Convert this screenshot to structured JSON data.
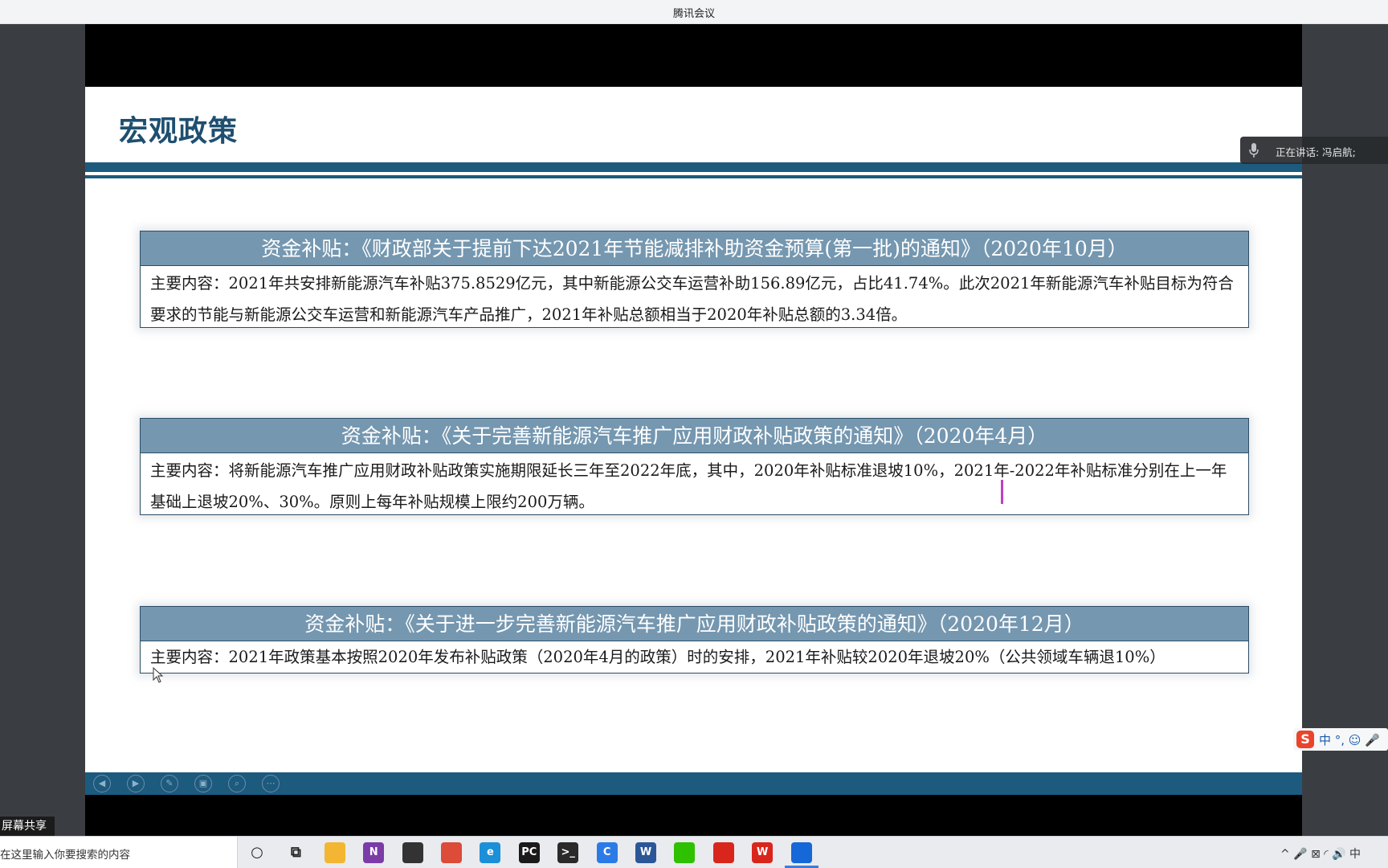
{
  "window": {
    "title": "腾讯会议"
  },
  "slide": {
    "title": "宏观政策",
    "cards": [
      {
        "heading": "资金补贴：《财政部关于提前下达2021年节能减排补助资金预算(第一批)的通知》（2020年10月）",
        "body": "主要内容：2021年共安排新能源汽车补贴375.8529亿元，其中新能源公交车运营补助156.89亿元，占比41.74%。此次2021年新能源汽车补贴目标为符合要求的节能与新能源公交车运营和新能源汽车产品推广，2021年补贴总额相当于2020年补贴总额的3.34倍。"
      },
      {
        "heading": "资金补贴：《关于完善新能源汽车推广应用财政补贴政策的通知》（2020年4月）",
        "body": "主要内容：将新能源汽车推广应用财政补贴政策实施期限延长三年至2022年底，其中，2020年补贴标准退坡10%，2021年-2022年补贴标准分别在上一年基础上退坡20%、30%。原则上每年补贴规模上限约200万辆。"
      },
      {
        "heading": "资金补贴：《关于进一步完善新能源汽车推广应用财政补贴政策的通知》（2020年12月）",
        "body": "主要内容：2021年政策基本按照2020年发布补贴政策（2020年4月的政策）时的安排，2021年补贴较2020年退坡20%（公共领域车辆退10%）"
      }
    ]
  },
  "speaking": {
    "text": "正在讲话: 冯启航;"
  },
  "screen_share_label": "屏幕共享",
  "ime": {
    "logo": "S",
    "items": "中 °, ☺ 🎤"
  },
  "taskbar": {
    "search_placeholder": "在这里输入你要搜索的内容",
    "apps": [
      {
        "name": "cortana-icon",
        "glyph": "○",
        "color": "#e9ebee"
      },
      {
        "name": "task-view-icon",
        "glyph": "⧉",
        "color": "#e9ebee"
      },
      {
        "name": "file-explorer-icon",
        "glyph": "",
        "color": "#f2b632"
      },
      {
        "name": "onenote-icon",
        "glyph": "N",
        "color": "#7b3ca8"
      },
      {
        "name": "sticky-notes-icon",
        "glyph": "",
        "color": "#333333"
      },
      {
        "name": "chrome-icon",
        "glyph": "",
        "color": "#dd4b39"
      },
      {
        "name": "edge-icon",
        "glyph": "e",
        "color": "#1b8fd8"
      },
      {
        "name": "pycharm-icon",
        "glyph": "PC",
        "color": "#1a1a1a"
      },
      {
        "name": "terminal-icon",
        "glyph": ">_",
        "color": "#2a2a2a"
      },
      {
        "name": "app-c-icon",
        "glyph": "C",
        "color": "#2b7be6"
      },
      {
        "name": "word-icon",
        "glyph": "W",
        "color": "#2b5797"
      },
      {
        "name": "wechat-icon",
        "glyph": "",
        "color": "#2dc100"
      },
      {
        "name": "acrobat-icon",
        "glyph": "",
        "color": "#d9261c"
      },
      {
        "name": "wps-icon",
        "glyph": "W",
        "color": "#d9261c"
      },
      {
        "name": "tencent-meeting-icon",
        "glyph": "",
        "color": "#1667d8"
      }
    ],
    "tray": "^ 🎤 ⊠ ◜ 🔊 中"
  }
}
